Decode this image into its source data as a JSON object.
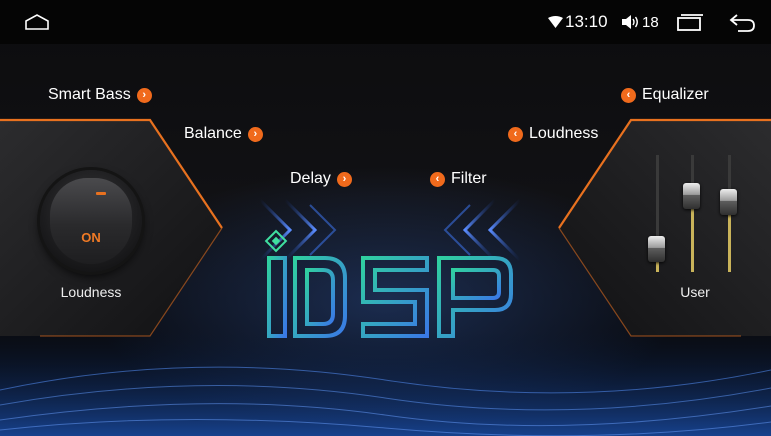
{
  "status_bar": {
    "time": "13:10",
    "volume": "18",
    "icons": [
      "home-icon",
      "wifi-icon",
      "volume-icon",
      "recent-apps-icon",
      "back-icon"
    ]
  },
  "menu": {
    "smart_bass": "Smart Bass",
    "balance": "Balance",
    "delay": "Delay",
    "filter": "Filter",
    "loudness": "Loudness",
    "equalizer": "Equalizer"
  },
  "loudness_toggle": {
    "state": "ON",
    "label": "Loudness"
  },
  "eq_preset": {
    "label": "User",
    "slider_levels": [
      0.2,
      0.65,
      0.6
    ]
  },
  "logo": {
    "text": "DSP",
    "icon": "chip-icon"
  },
  "colors": {
    "accent": "#f06a1c",
    "logo_gradient": [
      "#30d0a0",
      "#3a78e6"
    ]
  }
}
